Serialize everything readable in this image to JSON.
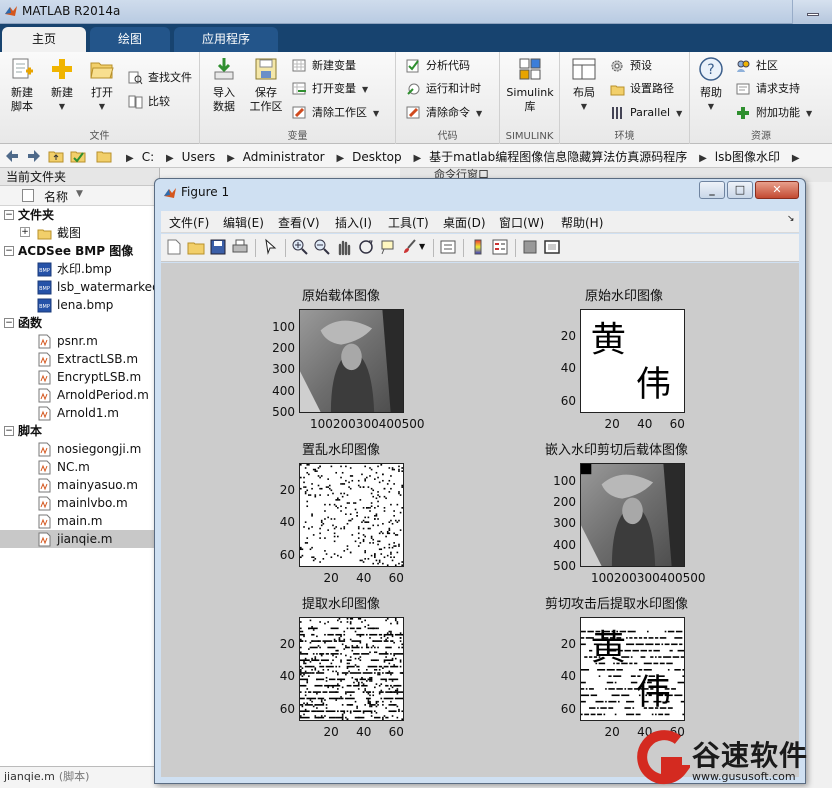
{
  "app": {
    "title": "MATLAB R2014a"
  },
  "tabs": [
    {
      "label": "主页",
      "active": true
    },
    {
      "label": "绘图",
      "active": false
    },
    {
      "label": "应用程序",
      "active": false
    }
  ],
  "ribbon": {
    "file": {
      "caption": "文件",
      "new_script": "新建\n脚本",
      "new": "新建",
      "open": "打开",
      "find_files": "查找文件",
      "compare": "比较"
    },
    "variable": {
      "caption": "变量",
      "import": "导入\n数据",
      "save_ws": "保存\n工作区",
      "new_var": "新建变量",
      "open_var": "打开变量",
      "clear_ws": "清除工作区"
    },
    "code": {
      "caption": "代码",
      "analyze": "分析代码",
      "run_time": "运行和计时",
      "clear_cmd": "清除命令"
    },
    "simulink": {
      "caption": "SIMULINK",
      "lib": "Simulink\n库"
    },
    "env": {
      "caption": "环境",
      "layout": "布局",
      "prefs": "预设",
      "set_path": "设置路径",
      "parallel": "Parallel"
    },
    "resources": {
      "caption": "资源",
      "help": "帮助",
      "community": "社区",
      "request_support": "请求支持",
      "addons": "附加功能"
    }
  },
  "address": {
    "path": [
      "C:",
      "Users",
      "Administrator",
      "Desktop",
      "基于matlab编程图像信息隐藏算法仿真源码程序",
      "lsb图像水印"
    ]
  },
  "current_folder": {
    "title": "当前文件夹",
    "col_name": "名称",
    "groups": [
      {
        "label": "文件夹",
        "items": [
          {
            "name": "截图",
            "type": "folder"
          }
        ]
      },
      {
        "label": "ACDSee BMP 图像",
        "items": [
          {
            "name": "水印.bmp",
            "type": "bmp"
          },
          {
            "name": "lsb_watermarked",
            "type": "bmp"
          },
          {
            "name": "lena.bmp",
            "type": "bmp"
          }
        ]
      },
      {
        "label": "函数",
        "items": [
          {
            "name": "psnr.m",
            "type": "m"
          },
          {
            "name": "ExtractLSB.m",
            "type": "m"
          },
          {
            "name": "EncryptLSB.m",
            "type": "m"
          },
          {
            "name": "ArnoldPeriod.m",
            "type": "m"
          },
          {
            "name": "Arnold1.m",
            "type": "m"
          }
        ]
      },
      {
        "label": "脚本",
        "items": [
          {
            "name": "nosiegongji.m",
            "type": "m"
          },
          {
            "name": "NC.m",
            "type": "m"
          },
          {
            "name": "mainyasuo.m",
            "type": "m"
          },
          {
            "name": "mainlvbo.m",
            "type": "m"
          },
          {
            "name": "main.m",
            "type": "m"
          },
          {
            "name": "jianqie.m",
            "type": "m",
            "selected": true
          }
        ]
      }
    ],
    "status_name": "jianqie.m",
    "status_type": "(脚本)"
  },
  "command_window": {
    "title": "命令行窗口"
  },
  "figure": {
    "title": "Figure 1",
    "menus": [
      "文件(F)",
      "编辑(E)",
      "查看(V)",
      "插入(I)",
      "工具(T)",
      "桌面(D)",
      "窗口(W)",
      "帮助(H)"
    ],
    "axes": [
      {
        "title": "原始载体图像",
        "yticks": [
          "100",
          "200",
          "300",
          "400",
          "500"
        ],
        "xticks": "100200300400500",
        "kind": "photo"
      },
      {
        "title": "原始水印图像",
        "yticks": [
          "20",
          "40",
          "60"
        ],
        "xticks": [
          "20",
          "40",
          "60"
        ],
        "kind": "wm",
        "glyphs": [
          "黄",
          "伟"
        ]
      },
      {
        "title": "置乱水印图像",
        "yticks": [
          "20",
          "40",
          "60"
        ],
        "xticks": [
          "20",
          "40",
          "60"
        ],
        "kind": "noise"
      },
      {
        "title": "嵌入水印剪切后载体图像",
        "yticks": [
          "100",
          "200",
          "300",
          "400",
          "500"
        ],
        "xticks": "100200300400500",
        "kind": "photo-cut"
      },
      {
        "title": "提取水印图像",
        "yticks": [
          "20",
          "40",
          "60"
        ],
        "xticks": [
          "20",
          "40",
          "60"
        ],
        "kind": "noise-lines"
      },
      {
        "title": "剪切攻击后提取水印图像",
        "yticks": [
          "20",
          "40",
          "60"
        ],
        "xticks": [
          "20",
          "40",
          "60"
        ],
        "kind": "wm-lines",
        "glyphs": [
          "黄",
          "伟"
        ]
      }
    ]
  },
  "watermark": {
    "brand": "谷速软件",
    "url": "www.gususoft.com"
  }
}
